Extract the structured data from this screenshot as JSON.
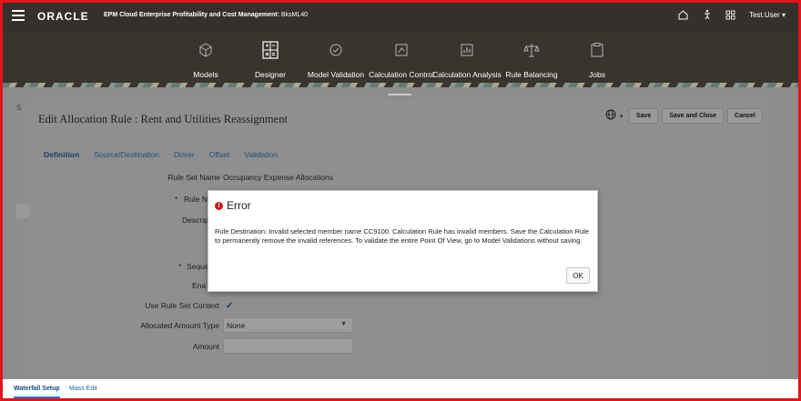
{
  "header": {
    "logo": "ORACLE",
    "app_title": "EPM Cloud Enterprise Profitability and Cost Management:",
    "instance": "BksML40",
    "user": "Test.User ▾"
  },
  "nav": {
    "items": [
      {
        "label": "Models",
        "icon": "cube-icon"
      },
      {
        "label": "Designer",
        "icon": "calculator-icon"
      },
      {
        "label": "Model Validation",
        "icon": "validation-icon"
      },
      {
        "label": "Calculation Control",
        "icon": "control-icon"
      },
      {
        "label": "Calculation Analysis",
        "icon": "analysis-icon"
      },
      {
        "label": "Rule Balancing",
        "icon": "balance-icon"
      },
      {
        "label": "Jobs",
        "icon": "clipboard-icon"
      }
    ]
  },
  "panel": {
    "title": "Edit Allocation Rule : Rent and Utilities Reassignment",
    "save_label": "Save",
    "save_close_label": "Save and Close",
    "cancel_label": "Cancel",
    "globe_caret": "▾"
  },
  "tabs": [
    "Definition",
    "Source/Destination",
    "Driver",
    "Offset",
    "Validation"
  ],
  "form": {
    "rule_set_name_label": "Rule Set Name",
    "rule_set_name_value": "Occupancy Expense Allocations",
    "rule_name_label": "Rule Na",
    "description_label": "Descrip",
    "sequence_label": "Seque",
    "enabled_label": "Ena",
    "use_rule_set_context_label": "Use Rule Set Context",
    "allocated_amount_type_label": "Allocated Amount Type",
    "allocated_amount_type_value": "None",
    "amount_label": "Amount",
    "required_marker": "*"
  },
  "left_strip": {
    "text": "S"
  },
  "bottom_tabs": [
    "Waterfall Setup",
    "Mass Edit"
  ],
  "dialog": {
    "title": "Error",
    "message": "Rule Destination: Invalid selected member name CC9100. Calculation Rule has invalid members. Save the Calculation Rule to permanently remove the invalid references. To validate the entire Point Of View, go to Model Validations without saving.",
    "ok_label": "OK"
  },
  "colors": {
    "border": "#e2131a",
    "header_bg": "#35302b",
    "error": "#c81e1e",
    "link": "#1f5f9e"
  }
}
